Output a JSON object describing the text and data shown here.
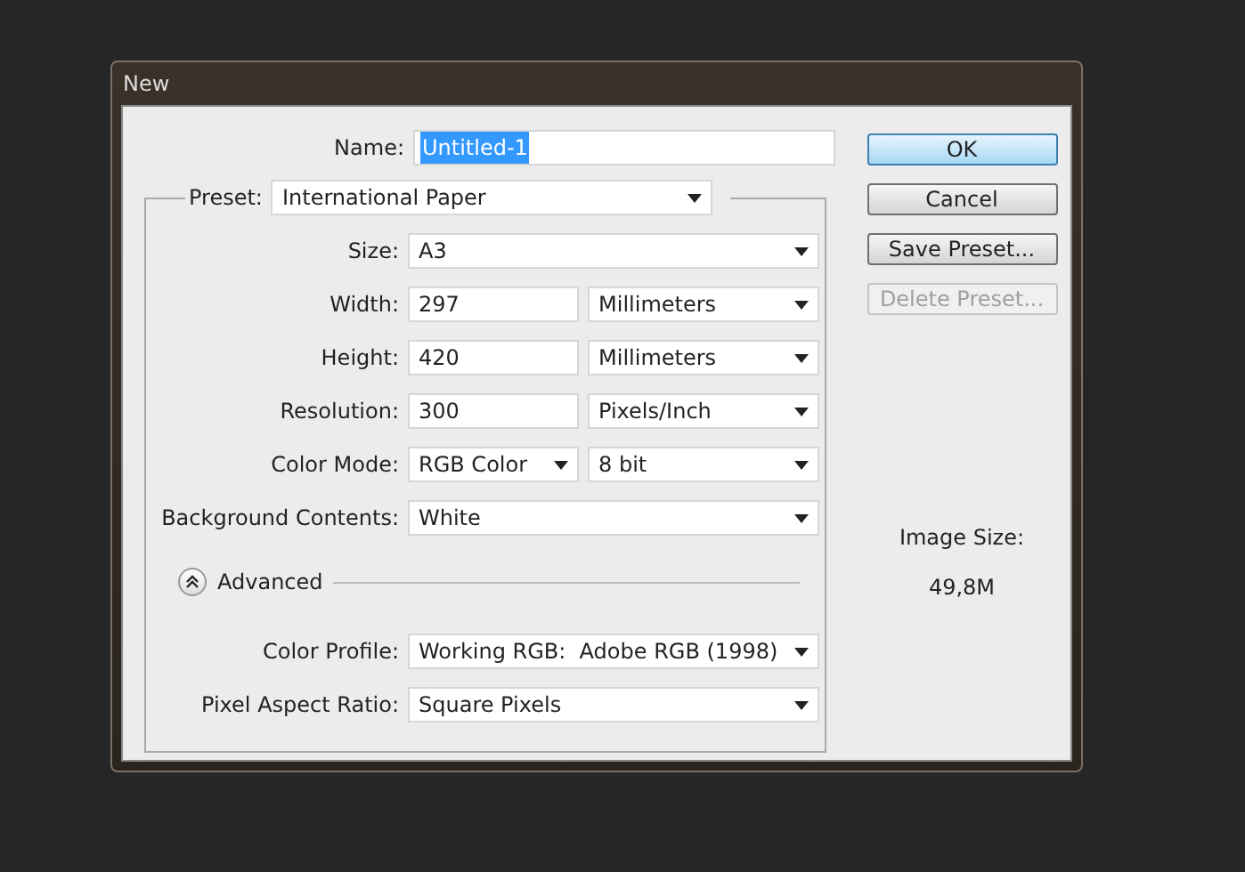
{
  "window": {
    "title": "New"
  },
  "name": {
    "label": "Name:",
    "value": "Untitled-1",
    "highlighted": true
  },
  "preset": {
    "label": "Preset:",
    "value": "International Paper"
  },
  "rows": [
    {
      "label": "Size:",
      "controls": [
        {
          "kind": "select",
          "value": "A3"
        }
      ]
    },
    {
      "label": "Width:",
      "controls": [
        {
          "kind": "input",
          "value": "297"
        },
        {
          "kind": "select",
          "value": "Millimeters"
        }
      ]
    },
    {
      "label": "Height:",
      "controls": [
        {
          "kind": "input",
          "value": "420"
        },
        {
          "kind": "select",
          "value": "Millimeters"
        }
      ]
    },
    {
      "label": "Resolution:",
      "controls": [
        {
          "kind": "input",
          "value": "300"
        },
        {
          "kind": "select",
          "value": "Pixels/Inch"
        }
      ]
    },
    {
      "label": "Color Mode:",
      "controls": [
        {
          "kind": "select",
          "value": "RGB Color"
        },
        {
          "kind": "select",
          "value": "8 bit"
        }
      ]
    },
    {
      "label": "Background Contents:",
      "controls": [
        {
          "kind": "select",
          "value": "White"
        }
      ]
    }
  ],
  "advanced": {
    "label": "Advanced",
    "expanded": true
  },
  "advanced_rows": [
    {
      "label": "Color Profile:",
      "controls": [
        {
          "kind": "select",
          "value": "Working RGB:  Adobe RGB (1998)"
        }
      ]
    },
    {
      "label": "Pixel Aspect Ratio:",
      "controls": [
        {
          "kind": "select",
          "value": "Square Pixels"
        }
      ]
    }
  ],
  "buttons": [
    {
      "label": "OK",
      "default": true,
      "disabled": false
    },
    {
      "label": "Cancel",
      "default": false,
      "disabled": false
    },
    {
      "label": "Save Preset...",
      "default": false,
      "disabled": false
    },
    {
      "label": "Delete Preset...",
      "default": false,
      "disabled": true
    }
  ],
  "image_size": {
    "label": "Image Size:",
    "value": "49,8M"
  }
}
